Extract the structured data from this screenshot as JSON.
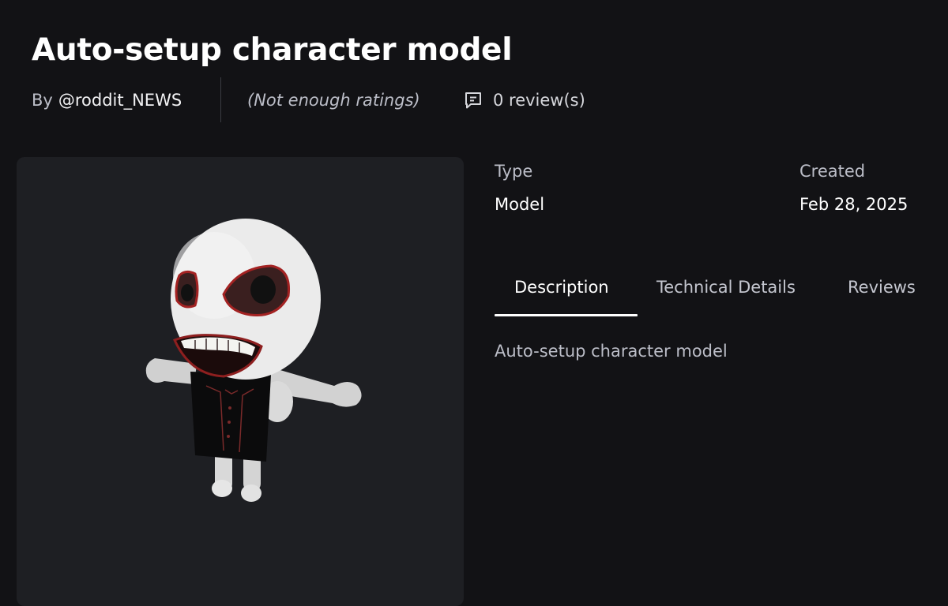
{
  "asset": {
    "title": "Auto-setup character model",
    "by_prefix": "By",
    "creator": "@roddit_NEWS",
    "rating_text": "(Not enough ratings)",
    "reviews_text": "0 review(s)",
    "thumbnail_icon": "character-model-thumbnail"
  },
  "details": {
    "type_label": "Type",
    "type_value": "Model",
    "created_label": "Created",
    "created_value": "Feb 28, 2025"
  },
  "tabs": [
    {
      "label": "Description",
      "active": true
    },
    {
      "label": "Technical Details",
      "active": false
    },
    {
      "label": "Reviews",
      "active": false
    }
  ],
  "description": "Auto-setup character model",
  "icons": {
    "reviews": "comment-icon"
  },
  "colors": {
    "background": "#121215",
    "panel": "#1e1f23",
    "text_primary": "#ffffff",
    "text_secondary": "#bcbec8",
    "divider": "#3b3c42"
  }
}
